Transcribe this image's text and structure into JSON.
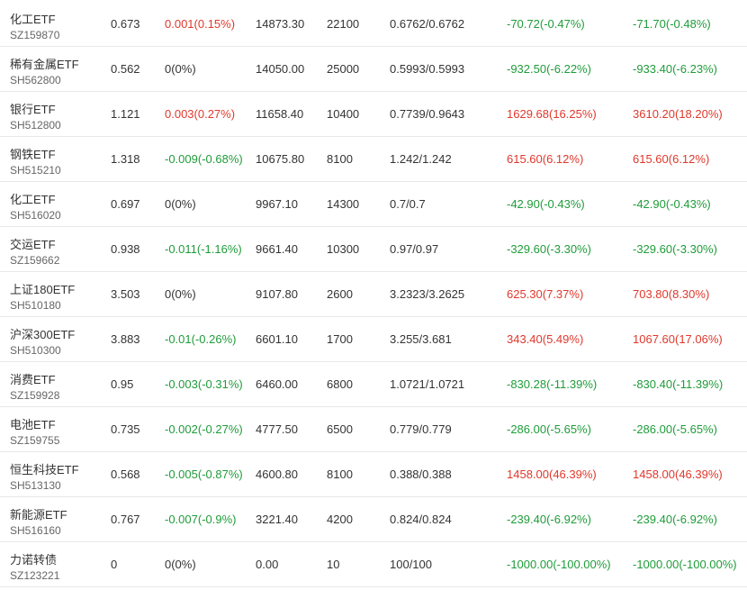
{
  "colors": {
    "up": "#e0382c",
    "down": "#1f9c3a",
    "neutral": "#333333"
  },
  "rows": [
    {
      "name": "化工ETF",
      "code": "SZ159870",
      "price": "0.673",
      "change": "0.001(0.15%)",
      "change_dir": "up",
      "amount": "14873.30",
      "qty": "22100",
      "cost": "0.6762/0.6762",
      "pnl": "-70.72(-0.47%)",
      "pnl_dir": "down",
      "total": "-71.70(-0.48%)",
      "total_dir": "down"
    },
    {
      "name": "稀有金属ETF",
      "code": "SH562800",
      "price": "0.562",
      "change": "0(0%)",
      "change_dir": "flat",
      "amount": "14050.00",
      "qty": "25000",
      "cost": "0.5993/0.5993",
      "pnl": "-932.50(-6.22%)",
      "pnl_dir": "down",
      "total": "-933.40(-6.23%)",
      "total_dir": "down"
    },
    {
      "name": "银行ETF",
      "code": "SH512800",
      "price": "1.121",
      "change": "0.003(0.27%)",
      "change_dir": "up",
      "amount": "11658.40",
      "qty": "10400",
      "cost": "0.7739/0.9643",
      "pnl": "1629.68(16.25%)",
      "pnl_dir": "up",
      "total": "3610.20(18.20%)",
      "total_dir": "up"
    },
    {
      "name": "钢铁ETF",
      "code": "SH515210",
      "price": "1.318",
      "change": "-0.009(-0.68%)",
      "change_dir": "down",
      "amount": "10675.80",
      "qty": "8100",
      "cost": "1.242/1.242",
      "pnl": "615.60(6.12%)",
      "pnl_dir": "up",
      "total": "615.60(6.12%)",
      "total_dir": "up"
    },
    {
      "name": "化工ETF",
      "code": "SH516020",
      "price": "0.697",
      "change": "0(0%)",
      "change_dir": "flat",
      "amount": "9967.10",
      "qty": "14300",
      "cost": "0.7/0.7",
      "pnl": "-42.90(-0.43%)",
      "pnl_dir": "down",
      "total": "-42.90(-0.43%)",
      "total_dir": "down"
    },
    {
      "name": "交运ETF",
      "code": "SZ159662",
      "price": "0.938",
      "change": "-0.011(-1.16%)",
      "change_dir": "down",
      "amount": "9661.40",
      "qty": "10300",
      "cost": "0.97/0.97",
      "pnl": "-329.60(-3.30%)",
      "pnl_dir": "down",
      "total": "-329.60(-3.30%)",
      "total_dir": "down"
    },
    {
      "name": "上证180ETF",
      "code": "SH510180",
      "price": "3.503",
      "change": "0(0%)",
      "change_dir": "flat",
      "amount": "9107.80",
      "qty": "2600",
      "cost": "3.2323/3.2625",
      "pnl": "625.30(7.37%)",
      "pnl_dir": "up",
      "total": "703.80(8.30%)",
      "total_dir": "up"
    },
    {
      "name": "沪深300ETF",
      "code": "SH510300",
      "price": "3.883",
      "change": "-0.01(-0.26%)",
      "change_dir": "down",
      "amount": "6601.10",
      "qty": "1700",
      "cost": "3.255/3.681",
      "pnl": "343.40(5.49%)",
      "pnl_dir": "up",
      "total": "1067.60(17.06%)",
      "total_dir": "up"
    },
    {
      "name": "消费ETF",
      "code": "SZ159928",
      "price": "0.95",
      "change": "-0.003(-0.31%)",
      "change_dir": "down",
      "amount": "6460.00",
      "qty": "6800",
      "cost": "1.0721/1.0721",
      "pnl": "-830.28(-11.39%)",
      "pnl_dir": "down",
      "total": "-830.40(-11.39%)",
      "total_dir": "down"
    },
    {
      "name": "电池ETF",
      "code": "SZ159755",
      "price": "0.735",
      "change": "-0.002(-0.27%)",
      "change_dir": "down",
      "amount": "4777.50",
      "qty": "6500",
      "cost": "0.779/0.779",
      "pnl": "-286.00(-5.65%)",
      "pnl_dir": "down",
      "total": "-286.00(-5.65%)",
      "total_dir": "down"
    },
    {
      "name": "恒生科技ETF",
      "code": "SH513130",
      "price": "0.568",
      "change": "-0.005(-0.87%)",
      "change_dir": "down",
      "amount": "4600.80",
      "qty": "8100",
      "cost": "0.388/0.388",
      "pnl": "1458.00(46.39%)",
      "pnl_dir": "up",
      "total": "1458.00(46.39%)",
      "total_dir": "up"
    },
    {
      "name": "新能源ETF",
      "code": "SH516160",
      "price": "0.767",
      "change": "-0.007(-0.9%)",
      "change_dir": "down",
      "amount": "3221.40",
      "qty": "4200",
      "cost": "0.824/0.824",
      "pnl": "-239.40(-6.92%)",
      "pnl_dir": "down",
      "total": "-239.40(-6.92%)",
      "total_dir": "down"
    },
    {
      "name": "力诺转债",
      "code": "SZ123221",
      "price": "0",
      "change": "0(0%)",
      "change_dir": "flat",
      "amount": "0.00",
      "qty": "10",
      "cost": "100/100",
      "pnl": "-1000.00(-100.00%)",
      "pnl_dir": "down",
      "total": "-1000.00(-100.00%)",
      "total_dir": "down"
    }
  ]
}
